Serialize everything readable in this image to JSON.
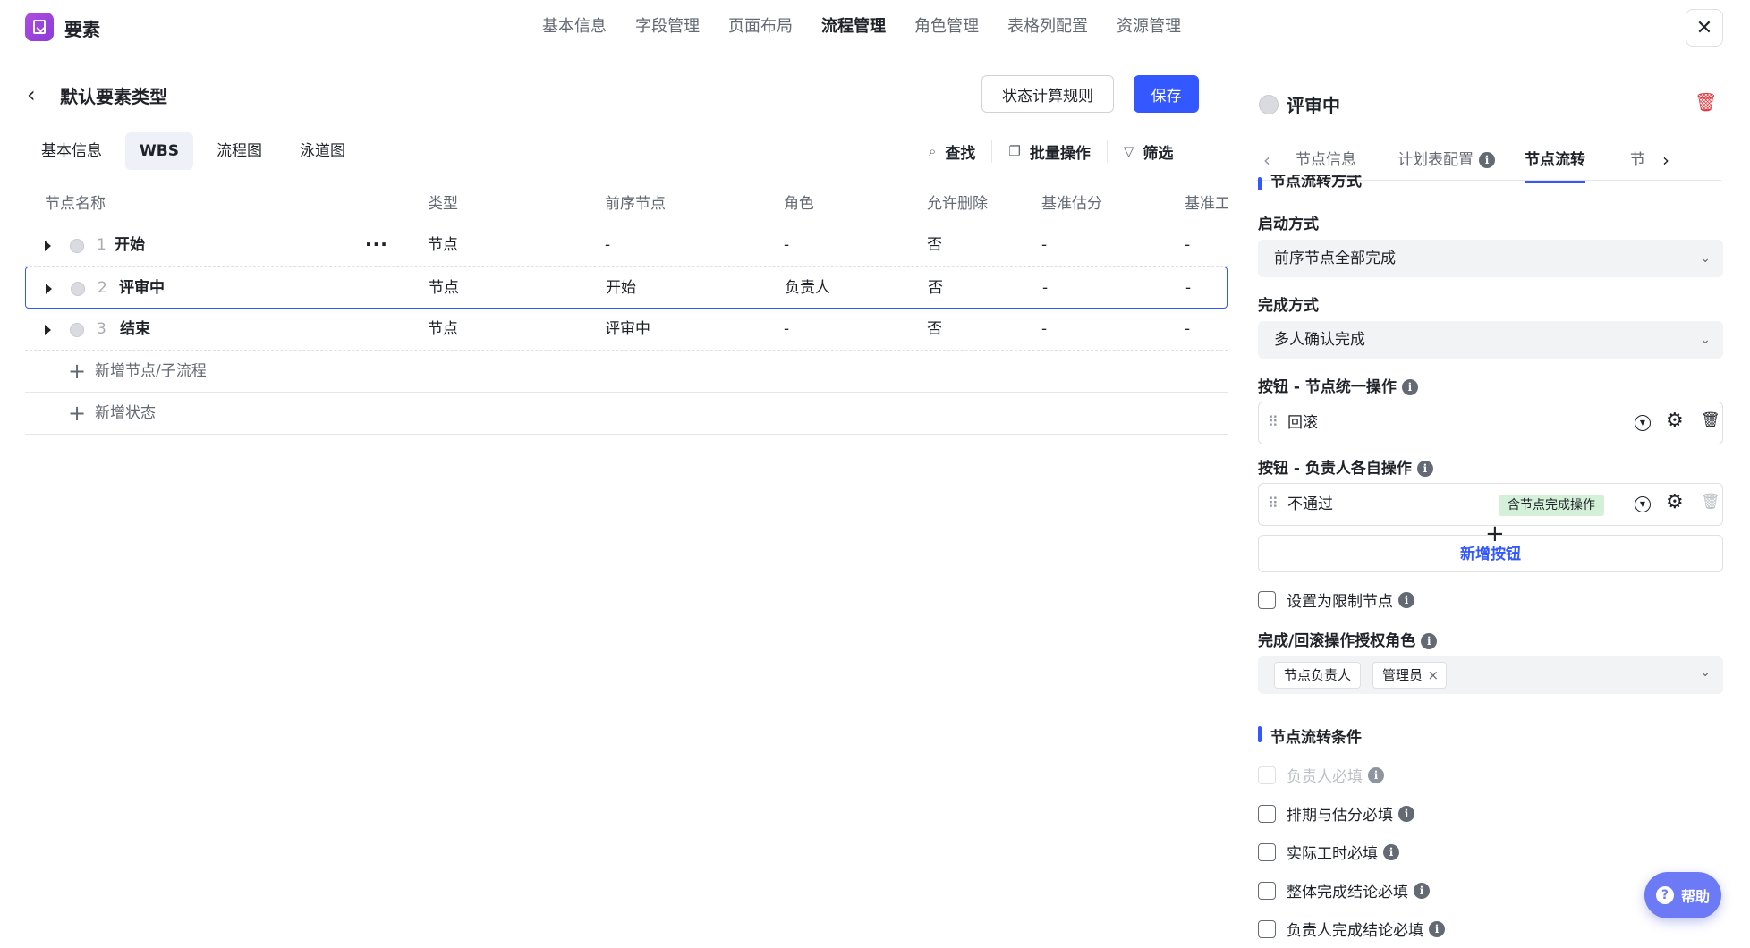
{
  "app": {
    "title": "要素"
  },
  "topnav": [
    "基本信息",
    "字段管理",
    "页面布局",
    "流程管理",
    "角色管理",
    "表格列配置",
    "资源管理"
  ],
  "topnav_active": "流程管理",
  "header": {
    "title": "默认要素类型",
    "rule_button": "状态计算规则",
    "save_button": "保存"
  },
  "subtabs": [
    "基本信息",
    "WBS",
    "流程图",
    "泳道图"
  ],
  "subtab_active": "WBS",
  "tools": {
    "find": "查找",
    "batch": "批量操作",
    "filter": "筛选"
  },
  "table": {
    "columns": [
      "节点名称",
      "类型",
      "前序节点",
      "角色",
      "允许删除",
      "基准估分",
      "基准工"
    ],
    "rows": [
      {
        "num": "1",
        "name": "开始",
        "type": "节点",
        "prev": "-",
        "role": "-",
        "deletable": "否",
        "estimate": "-",
        "work": "-"
      },
      {
        "num": "2",
        "name": "评审中",
        "type": "节点",
        "prev": "开始",
        "role": "负责人",
        "deletable": "否",
        "estimate": "-",
        "work": "-"
      },
      {
        "num": "3",
        "name": "结束",
        "type": "节点",
        "prev": "评审中",
        "role": "-",
        "deletable": "否",
        "estimate": "-",
        "work": "-"
      }
    ],
    "add_node": "新增节点/子流程",
    "add_state": "新增状态"
  },
  "panel": {
    "title": "评审中",
    "tabs": [
      "节点信息",
      "计划表配置",
      "节点流转",
      "节"
    ],
    "active_tab": "节点流转",
    "section_flow": "节点流转方式",
    "start_label": "启动方式",
    "start_value": "前序节点全部完成",
    "finish_label": "完成方式",
    "finish_value": "多人确认完成",
    "unified_label": "按钮 - 节点统一操作",
    "unified_button": "回滚",
    "individual_label": "按钮 - 负责人各自操作",
    "individual_button": "不通过",
    "individual_tag": "含节点完成操作",
    "add_button": "新增按钮",
    "restrict_label": "设置为限制节点",
    "auth_label": "完成/回滚操作授权角色",
    "auth_roles": [
      "节点负责人",
      "管理员"
    ],
    "section_cond": "节点流转条件",
    "conditions": [
      "负责人必填",
      "排期与估分必填",
      "实际工时必填",
      "整体完成结论必填",
      "负责人完成结论必填"
    ]
  },
  "help": "帮助",
  "colors": {
    "primary": "#3358ff",
    "danger": "#e5363d",
    "tag_green": "#d5f0d9"
  }
}
